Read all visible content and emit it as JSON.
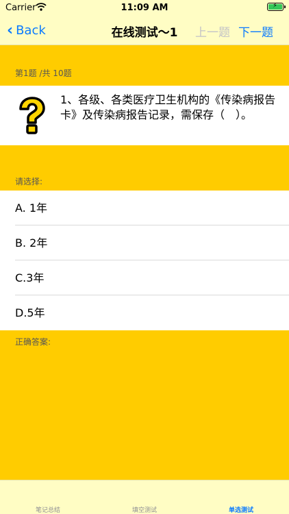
{
  "status_bar": {
    "carrier": "Carrier",
    "time": "11:09 AM"
  },
  "nav": {
    "back_label": "Back",
    "title": "在线测试～1",
    "prev_label": "上一题",
    "next_label": "下一题"
  },
  "question": {
    "progress": "第1题 /共 10题",
    "text": "1、各级、各类医疗卫生机构的《传染病报告卡》及传染病报告记录，需保存（　）。",
    "icon": "question-mark-icon"
  },
  "choices": {
    "prompt": "请选择:",
    "options": [
      {
        "label": "A.  1年"
      },
      {
        "label": "B.  2年"
      },
      {
        "label": "C.3年"
      },
      {
        "label": "D.5年"
      }
    ]
  },
  "answer": {
    "label": "正确答案:"
  },
  "tabs": [
    {
      "label": "笔记总结",
      "active": false
    },
    {
      "label": "填空测试",
      "active": false
    },
    {
      "label": "单选测试",
      "active": true
    }
  ],
  "colors": {
    "background": "#FFCC00",
    "bars": "#FFFDC4",
    "accent": "#0A7AFF",
    "disabled": "#C3C3C7"
  }
}
